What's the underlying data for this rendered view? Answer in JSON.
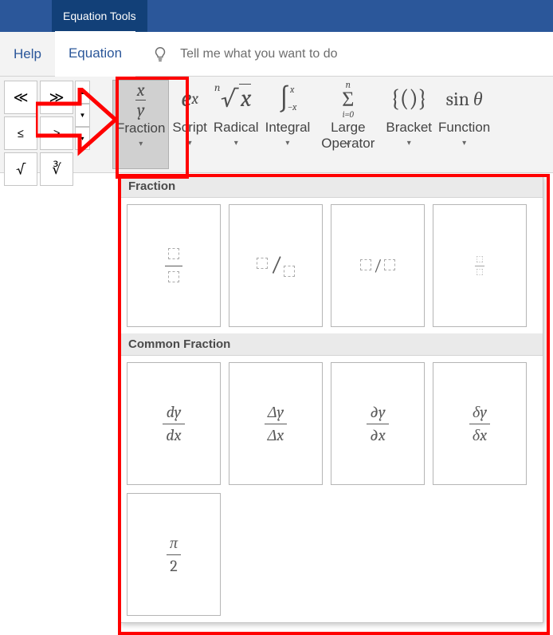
{
  "titlebar": {
    "equation_tools": "Equation Tools"
  },
  "tabs": {
    "help": "Help",
    "equation": "Equation",
    "tell_me": "Tell me what you want to do"
  },
  "symbols": {
    "ll": "≪",
    "gg": "≫",
    "leq": "≤",
    "geq": "≥",
    "sqrt": "√",
    "cbrt": "∛"
  },
  "structures": {
    "fraction": "Fraction",
    "script": "Script",
    "radical": "Radical",
    "integral": "Integral",
    "large_operator": "Large\nOperator",
    "bracket": "Bracket",
    "function": "Function"
  },
  "dropdown": {
    "section_fraction": "Fraction",
    "section_common": "Common Fraction",
    "common": {
      "dydx_num": "dy",
      "dydx_den": "dx",
      "DyDx_num": "Δy",
      "DyDx_den": "Δx",
      "pypx_num": "∂y",
      "pypx_den": "∂x",
      "dely_num": "δy",
      "dely_den": "δx",
      "pi2_num": "π",
      "pi2_den": "2"
    }
  }
}
